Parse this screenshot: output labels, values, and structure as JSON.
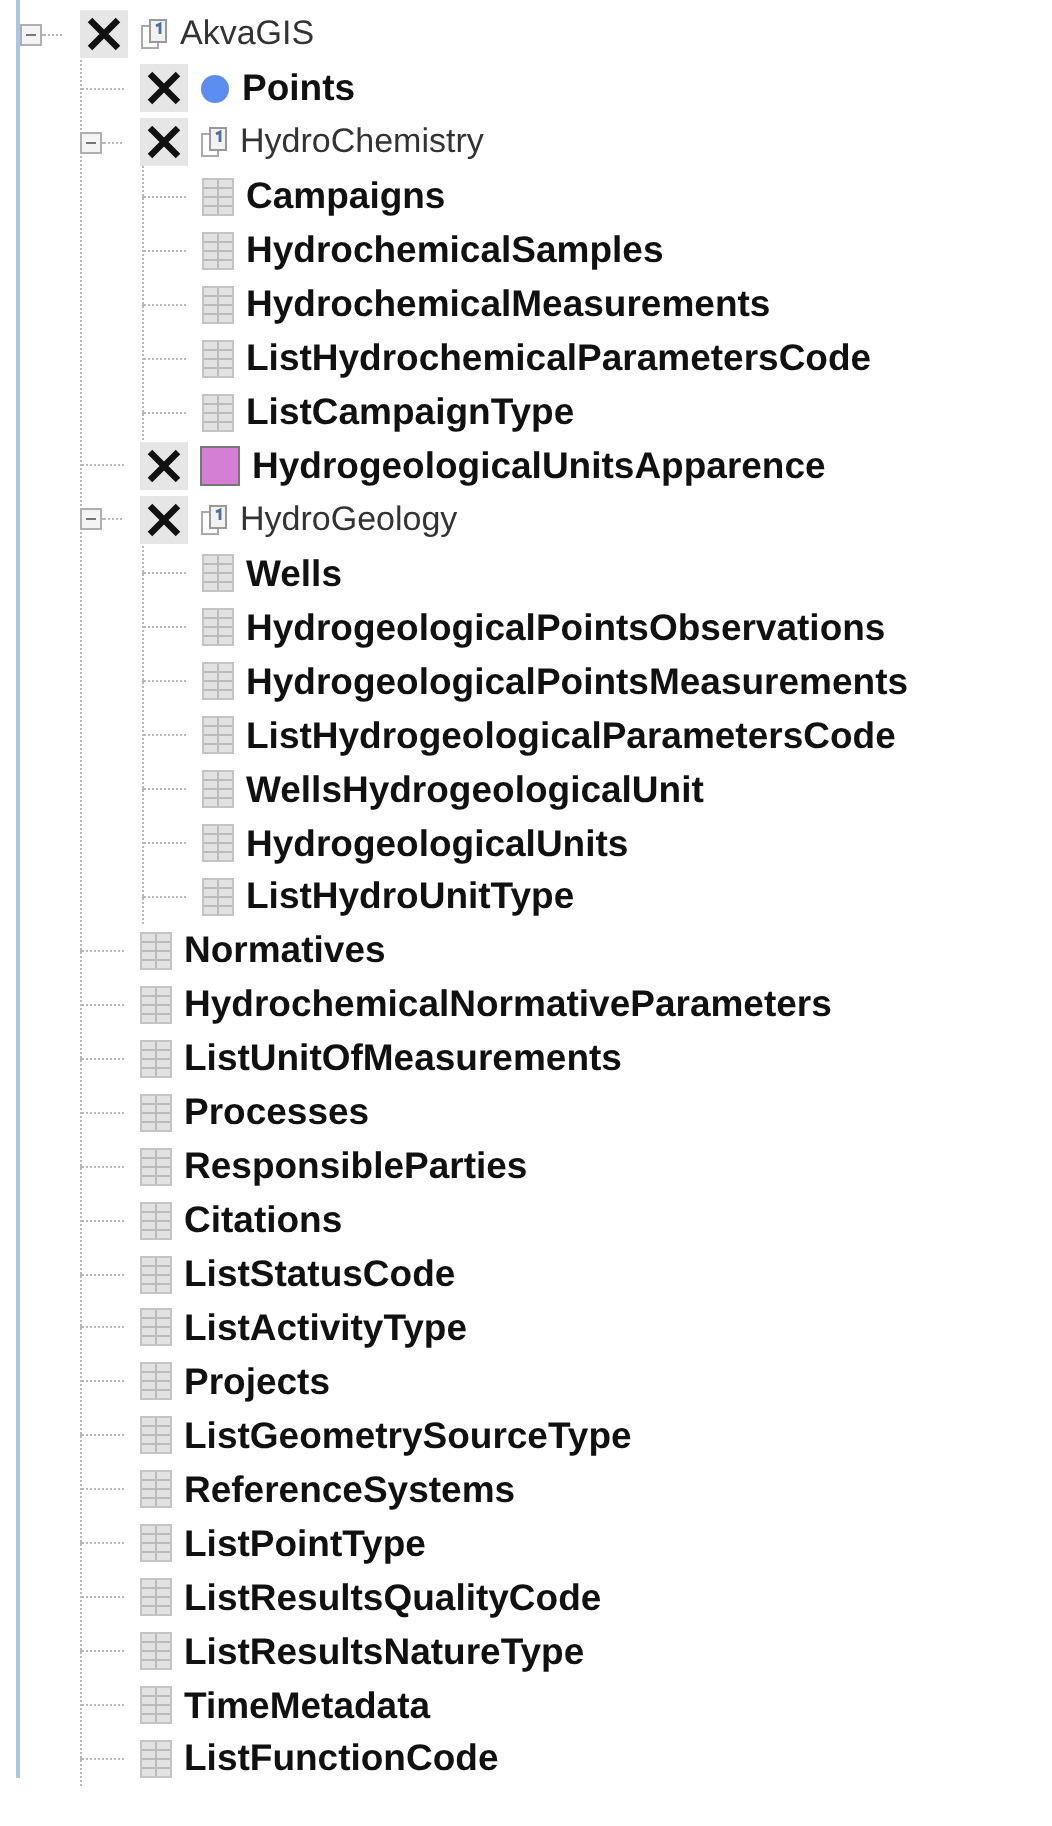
{
  "layer_tree": [
    {
      "kind": "group",
      "label": "AkvaGIS",
      "checked": true,
      "expanded": true,
      "children": [
        {
          "kind": "point-layer",
          "label": "Points",
          "checked": true,
          "color": "#5b8ef0"
        },
        {
          "kind": "group",
          "label": "HydroChemistry",
          "checked": true,
          "expanded": true,
          "children": [
            {
              "kind": "table",
              "label": "Campaigns"
            },
            {
              "kind": "table",
              "label": "HydrochemicalSamples"
            },
            {
              "kind": "table",
              "label": "HydrochemicalMeasurements"
            },
            {
              "kind": "table",
              "label": "ListHydrochemicalParametersCode"
            },
            {
              "kind": "table",
              "label": "ListCampaignType"
            }
          ]
        },
        {
          "kind": "polygon-layer",
          "label": "HydrogeologicalUnitsApparence",
          "checked": true,
          "color": "#d47fd4"
        },
        {
          "kind": "group",
          "label": "HydroGeology",
          "checked": true,
          "expanded": true,
          "children": [
            {
              "kind": "table",
              "label": "Wells"
            },
            {
              "kind": "table",
              "label": "HydrogeologicalPointsObservations"
            },
            {
              "kind": "table",
              "label": "HydrogeologicalPointsMeasurements"
            },
            {
              "kind": "table",
              "label": "ListHydrogeologicalParametersCode"
            },
            {
              "kind": "table",
              "label": "WellsHydrogeologicalUnit"
            },
            {
              "kind": "table",
              "label": "HydrogeologicalUnits"
            },
            {
              "kind": "table",
              "label": "ListHydroUnitType"
            }
          ]
        },
        {
          "kind": "table",
          "label": "Normatives"
        },
        {
          "kind": "table",
          "label": "HydrochemicalNormativeParameters"
        },
        {
          "kind": "table",
          "label": "ListUnitOfMeasurements"
        },
        {
          "kind": "table",
          "label": "Processes"
        },
        {
          "kind": "table",
          "label": "ResponsibleParties"
        },
        {
          "kind": "table",
          "label": "Citations"
        },
        {
          "kind": "table",
          "label": "ListStatusCode"
        },
        {
          "kind": "table",
          "label": "ListActivityType"
        },
        {
          "kind": "table",
          "label": "Projects"
        },
        {
          "kind": "table",
          "label": "ListGeometrySourceType"
        },
        {
          "kind": "table",
          "label": "ReferenceSystems"
        },
        {
          "kind": "table",
          "label": "ListPointType"
        },
        {
          "kind": "table",
          "label": "ListResultsQualityCode"
        },
        {
          "kind": "table",
          "label": "ListResultsNatureType"
        },
        {
          "kind": "table",
          "label": "TimeMetadata"
        },
        {
          "kind": "table",
          "label": "ListFunctionCode"
        }
      ]
    }
  ]
}
